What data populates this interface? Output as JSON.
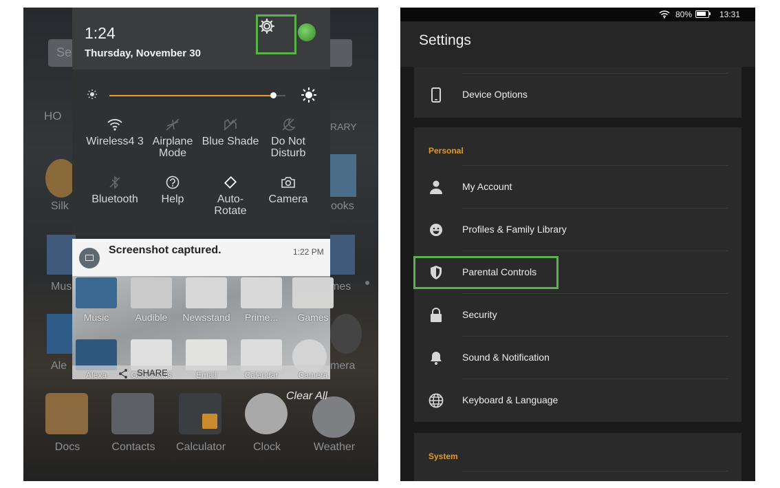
{
  "left": {
    "quick_settings": {
      "time": "1:24",
      "date": "Thursday, November 30",
      "tiles_row1": [
        {
          "label": "Wireless4 3",
          "icon": "wifi-icon"
        },
        {
          "label": "Airplane Mode",
          "icon": "airplane-icon"
        },
        {
          "label": "Blue Shade",
          "icon": "blue-shade-icon"
        },
        {
          "label": "Do Not Disturb",
          "icon": "do-not-disturb-icon"
        }
      ],
      "tiles_row2": [
        {
          "label": "Bluetooth",
          "icon": "bluetooth-icon"
        },
        {
          "label": "Help",
          "icon": "help-icon"
        },
        {
          "label": "Auto-Rotate",
          "icon": "auto-rotate-icon"
        },
        {
          "label": "Camera",
          "icon": "camera-icon"
        }
      ],
      "brightness": 0.93
    },
    "notification": {
      "title": "Screenshot captured.",
      "time": "1:22 PM",
      "share_label": "SHARE",
      "clear_all": "Clear All"
    },
    "apps_row1": [
      "Music",
      "Audible",
      "Newsstand",
      "Prime...",
      "Games"
    ],
    "apps_row2": [
      "Alexa",
      "Goodreads",
      "Email",
      "Calendar",
      "Camera"
    ],
    "background_labels": {
      "search": "Se",
      "home": "HO",
      "library": "RARY",
      "silk": "Silk",
      "books": "ooks",
      "music": "Mus",
      "games": "mes",
      "alexa": "Ale",
      "camera": "mera"
    },
    "dock": [
      "Docs",
      "Contacts",
      "Calculator",
      "Clock",
      "Weather"
    ]
  },
  "right": {
    "status": {
      "battery": "80%",
      "time": "13:31"
    },
    "title": "Settings",
    "device_options": "Device Options",
    "personal_header": "Personal",
    "personal_items": [
      {
        "label": "My Account",
        "icon": "person-icon"
      },
      {
        "label": "Profiles & Family Library",
        "icon": "face-icon"
      },
      {
        "label": "Parental Controls",
        "icon": "shield-icon"
      },
      {
        "label": "Security",
        "icon": "lock-icon"
      },
      {
        "label": "Sound & Notification",
        "icon": "bell-icon"
      },
      {
        "label": "Keyboard & Language",
        "icon": "globe-icon"
      }
    ],
    "system_header": "System"
  },
  "colors": {
    "highlight": "#59b54a",
    "accent": "#e59a1e",
    "brightness_track": "#e2a12a"
  }
}
